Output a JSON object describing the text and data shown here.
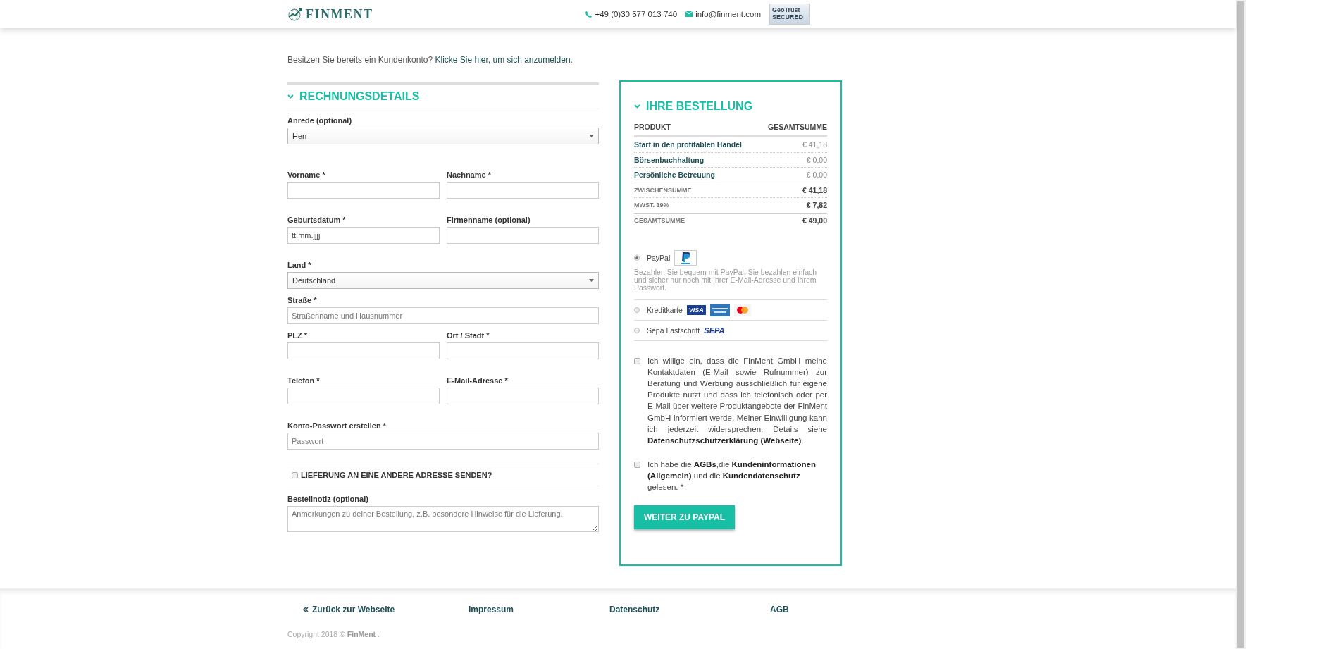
{
  "header": {
    "logo": "FINMENT",
    "phone": "+49 (0)30 577 013 740",
    "email": "info@finment.com",
    "seal": {
      "brand": "GeoTrust",
      "label": "SECURED"
    }
  },
  "login_notice": {
    "text": "Besitzen Sie bereits ein Kundenkonto?",
    "link": "Klicke Sie hier, um sich anzumelden."
  },
  "billing": {
    "title": "RECHNUNGSDETAILS",
    "expanded": true,
    "rows": [
      [
        {
          "label": "Anrede (optional)",
          "kind": "select",
          "value": "Herr"
        }
      ],
      [
        {
          "label": "Vorname",
          "mark": "*",
          "kind": "text"
        },
        {
          "label": "Nachname",
          "mark": "*",
          "kind": "text"
        }
      ],
      [
        {
          "label": "Geburtsdatum",
          "mark": "*",
          "kind": "text",
          "value": "tt.mm.jjjj"
        },
        {
          "label": "Firmenname (optional)",
          "kind": "text"
        }
      ],
      [
        {
          "label": "Land",
          "mark": "*",
          "kind": "select",
          "value": "Deutschland"
        }
      ],
      [
        {
          "label": "Straße",
          "mark": "*",
          "kind": "text",
          "placeholder": "Straßenname und Hausnummer"
        }
      ],
      [
        {
          "label": "PLZ",
          "mark": "*",
          "kind": "text"
        },
        {
          "label": "Ort / Stadt",
          "mark": "*",
          "kind": "text"
        }
      ],
      [
        {
          "label": "Telefon",
          "mark": "*",
          "kind": "text"
        },
        {
          "label": "E-Mail-Adresse",
          "mark": "*",
          "kind": "text"
        }
      ],
      [
        {
          "label": "Konto-Passwort erstellen",
          "mark": "*",
          "kind": "text",
          "placeholder": "Passwort"
        }
      ]
    ]
  },
  "shipping": {
    "label": "LIEFERUNG AN EINE ANDERE ADRESSE SENDEN?",
    "checked": false
  },
  "note": {
    "label": "Bestellnotiz (optional)",
    "kind": "textarea",
    "placeholder": "Anmerkungen zu deiner Bestellung, z.B. besondere Hinweise für die Lieferung."
  },
  "order": {
    "title": "IHRE BESTELLUNG",
    "expanded": true,
    "columns": [
      "PRODUKT",
      "GESAMTSUMME"
    ],
    "rows": [
      {
        "kind": "item",
        "label": "Start in den profitablen Handel",
        "value": "€ 41,18"
      },
      {
        "kind": "item",
        "label": "Börsenbuchhaltung",
        "value": "€ 0,00"
      },
      {
        "kind": "item",
        "label": "Persönliche Betreuung",
        "value": "€ 0,00"
      },
      {
        "kind": "summary",
        "label": "ZWISCHENSUMME",
        "value": "€ 41,18"
      },
      {
        "kind": "summary",
        "label": "MWST. 19%",
        "value": "€ 7,82"
      },
      {
        "kind": "summary",
        "label": "GESAMTSUMME",
        "value": "€ 49,00"
      }
    ]
  },
  "payments": [
    {
      "label": "PayPal",
      "selected": true,
      "logos": [
        {
          "kind": "paypal"
        }
      ],
      "description": "Bezahlen Sie bequem mit PayPal. Sie bezahlen einfach und sicher nur noch mit Ihrer E-Mail-Adresse und Ihrem Passwort."
    },
    {
      "label": "Kreditkarte",
      "selected": false,
      "logos": [
        {
          "kind": "visa",
          "text": "VISA"
        },
        {
          "kind": "amex"
        },
        {
          "kind": "mastercard"
        }
      ]
    },
    {
      "label": "Sepa Lastschrift",
      "selected": false,
      "logos": [
        {
          "kind": "sepa",
          "text": "SEPA"
        }
      ]
    }
  ],
  "consents": [
    {
      "checked": false,
      "justify": true,
      "text": "Ich willige ein, dass die FinMent GmbH meine Kontaktdaten (E-Mail sowie Rufnummer) zur Beratung und Werbung ausschließlich für eigene Produkte nutzt und dass ich telefonisch oder per E-Mail über weitere Produktangebote der FinMent GmbH informiert werde. Meiner Einwilligung kann ich jederzeit widersprechen. Details siehe **Datenschutzschutzerklärung (Webseite)**."
    },
    {
      "checked": false,
      "justify": false,
      "text": "Ich habe die **AGBs**,die **Kundeninformationen (Allgemein)** und die **Kundendatenschutz** gelesen.  *"
    }
  ],
  "submit": "WEITER ZU PAYPAL",
  "footer": {
    "links": [
      {
        "kind": "back",
        "label": "Zurück zur Webseite"
      },
      {
        "kind": "plain",
        "label": "Impressum"
      },
      {
        "kind": "plain",
        "label": "Datenschutz"
      },
      {
        "kind": "plain",
        "label": "AGB"
      }
    ],
    "copyright": "Copyright 2018 © **FinMent** ."
  }
}
